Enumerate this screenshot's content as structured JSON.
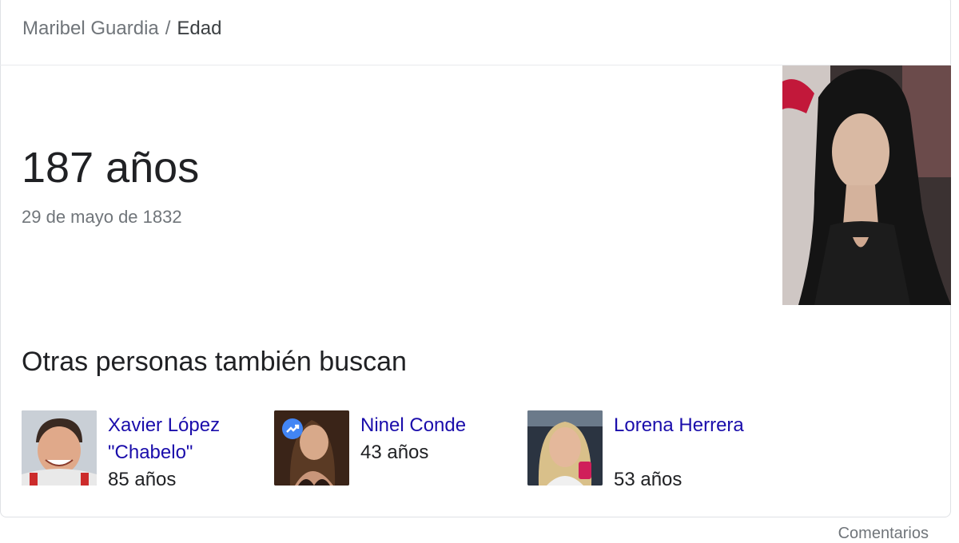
{
  "breadcrumb": {
    "subject": "Maribel Guardia",
    "separator": "/",
    "current": "Edad"
  },
  "answer": {
    "age": "187 años",
    "birth_date": "29 de mayo de 1832"
  },
  "hero_image": {
    "icon": "person-photo"
  },
  "related": {
    "title": "Otras personas también buscan",
    "people": [
      {
        "name": "Xavier López \"Chabelo\"",
        "age": "85 años",
        "thumb": "person-photo"
      },
      {
        "name": "Ninel Conde",
        "age": "43 años",
        "thumb": "person-photo",
        "badge": "trending-icon"
      },
      {
        "name": "Lorena Herrera",
        "age": "53 años",
        "thumb": "person-photo"
      }
    ]
  },
  "footer": {
    "feedback_label": "Comentarios"
  },
  "colors": {
    "link": "#1a0dab",
    "text": "#202124",
    "muted": "#70757a",
    "border": "#dfe1e5",
    "badge": "#4285f4"
  }
}
